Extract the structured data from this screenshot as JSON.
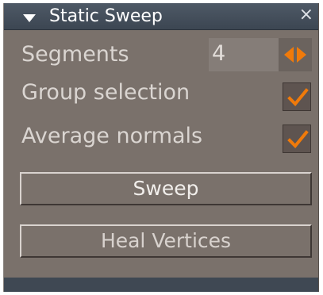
{
  "panel": {
    "title": "Static Sweep",
    "close_glyph": "×",
    "collapse_icon": "triangle-down",
    "close_icon": "close"
  },
  "segments": {
    "label": "Segments",
    "value": "4",
    "stepper_icon": "left-right-arrows",
    "accent_color": "#f07a0a"
  },
  "group_selection": {
    "label": "Group selection",
    "checked": true
  },
  "average_normals": {
    "label": "Average normals",
    "checked": true
  },
  "buttons": {
    "sweep": "Sweep",
    "heal_vertices": "Heal Vertices"
  },
  "colors": {
    "panel_bg": "#7a716b",
    "titlebar_bg": "#4b5662",
    "check_color": "#f07a0a"
  }
}
